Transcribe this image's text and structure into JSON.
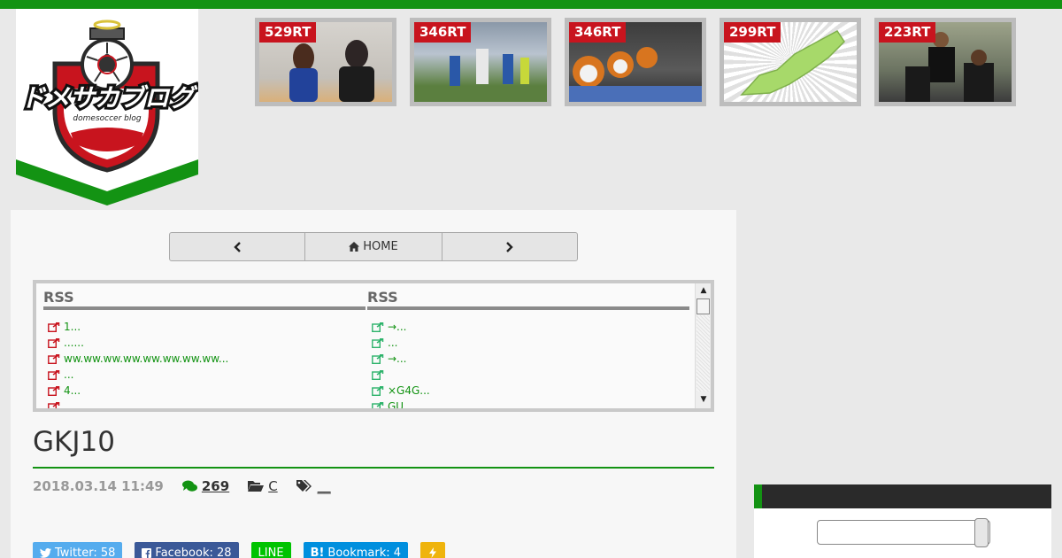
{
  "site": {
    "logo_text": "ドメサカブログ",
    "logo_subtext": "domesoccer blog"
  },
  "colors": {
    "accent": "#139313",
    "rt_badge": "#c8141e",
    "link": "#139313"
  },
  "thumbnails": [
    {
      "rt": "529RT",
      "subject": "two people in blue uniform and black jacket"
    },
    {
      "rt": "346RT",
      "subject": "soccer players in stadium"
    },
    {
      "rt": "346RT",
      "subject": "mascot figures in row"
    },
    {
      "rt": "299RT",
      "subject": "green map of region"
    },
    {
      "rt": "223RT",
      "subject": "players celebrating"
    }
  ],
  "nav": {
    "prev_icon": "chevron-left-icon",
    "home_label": "HOME",
    "home_icon": "home-icon",
    "next_icon": "chevron-right-icon"
  },
  "rss": {
    "left": {
      "heading": "RSS",
      "items": [
        "1...",
        "......",
        "ww.ww.ww.ww.ww.ww.ww.ww...",
        "...",
        "4...",
        ""
      ]
    },
    "right": {
      "heading": "RSS",
      "items": [
        "→...",
        "...",
        "→...",
        "",
        "×G4G...",
        "GU..."
      ]
    }
  },
  "post": {
    "title": "GKJ10",
    "date": "2018.03.14 11:49",
    "comments": "269",
    "category": "C",
    "tags": "__"
  },
  "shares": {
    "twitter": "Twitter: 58",
    "facebook": "Facebook: 28",
    "line": "LINE",
    "bookmark_prefix": "B!",
    "bookmark": "Bookmark: 4",
    "pocket_icon": "pocket-icon"
  },
  "sidebar": {
    "search_placeholder": ""
  }
}
